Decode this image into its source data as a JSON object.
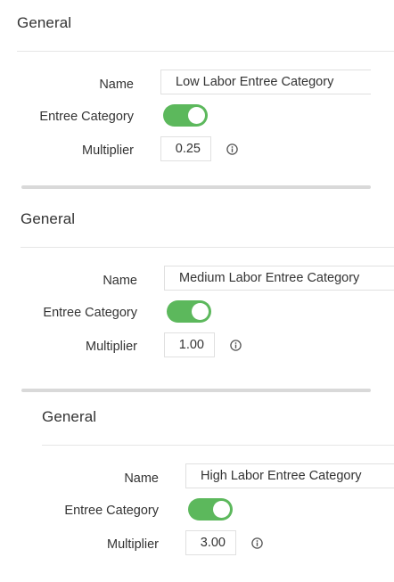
{
  "sections": [
    {
      "title": "General",
      "name_label": "Name",
      "name_value": "Low Labor Entree Category",
      "entree_label": "Entree Category",
      "entree_enabled": true,
      "multiplier_label": "Multiplier",
      "multiplier_value": "0.25"
    },
    {
      "title": "General",
      "name_label": "Name",
      "name_value": "Medium Labor Entree Category",
      "entree_label": "Entree Category",
      "entree_enabled": true,
      "multiplier_label": "Multiplier",
      "multiplier_value": "1.00"
    },
    {
      "title": "General",
      "name_label": "Name",
      "name_value": "High Labor Entree Category",
      "entree_label": "Entree Category",
      "entree_enabled": true,
      "multiplier_label": "Multiplier",
      "multiplier_value": "3.00"
    }
  ],
  "icons": {
    "info": "info-circle-icon"
  },
  "colors": {
    "toggle_on": "#5cb85c",
    "divider": "#d9d9d9",
    "rule": "#e6e6e6"
  }
}
